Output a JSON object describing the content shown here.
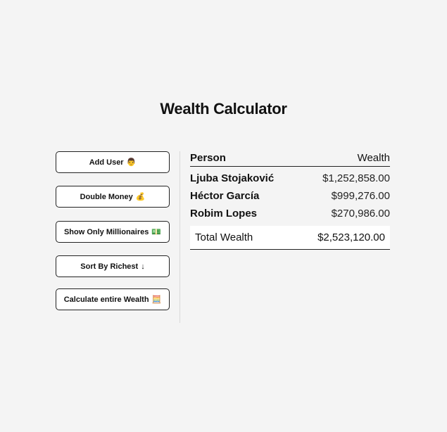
{
  "page": {
    "title": "Wealth Calculator"
  },
  "sidebar": {
    "buttons": [
      {
        "label": "Add User",
        "icon": "👨"
      },
      {
        "label": "Double Money",
        "icon": "💰"
      },
      {
        "label": "Show Only Millionaires",
        "icon": "💵"
      },
      {
        "label": "Sort By Richest",
        "icon": "↓"
      },
      {
        "label": "Calculate entire Wealth",
        "icon": "🧮"
      }
    ]
  },
  "table": {
    "header": {
      "person": "Person",
      "wealth": "Wealth"
    },
    "rows": [
      {
        "name": "Ljuba Stojaković",
        "wealth": "$1,252,858.00"
      },
      {
        "name": "Héctor García",
        "wealth": "$999,276.00"
      },
      {
        "name": "Robim Lopes",
        "wealth": "$270,986.00"
      }
    ],
    "total": {
      "label": "Total Wealth",
      "value": "$2,523,120.00"
    }
  }
}
